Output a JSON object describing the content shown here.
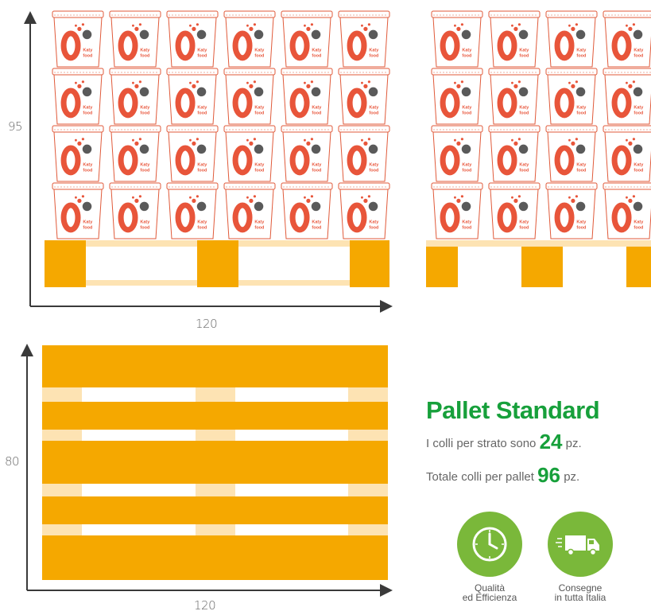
{
  "dimensions": {
    "front_height": "95",
    "front_width": "120",
    "top_depth": "80",
    "top_width": "120"
  },
  "product": {
    "brand_line1": "Katy",
    "brand_line2": "food",
    "rows": 4,
    "front_columns": 6
  },
  "info": {
    "title": "Pallet Standard",
    "per_layer_text": "I colli per strato sono",
    "per_layer_value": "24",
    "per_layer_unit": "pz.",
    "total_text": "Totale colli per pallet",
    "total_value": "96",
    "total_unit": "pz."
  },
  "badges": [
    {
      "icon": "clock-icon",
      "line1": "Qualità",
      "line2": "ed Efficienza"
    },
    {
      "icon": "truck-icon",
      "line1": "Consegne",
      "line2": "in tutta Italia"
    }
  ],
  "colors": {
    "pallet": "#f5a800",
    "pallet_light": "#fde3b3",
    "bucket_outline": "#e05a3a",
    "logo": "#e8553a",
    "accent_green": "#17a03b",
    "badge_green": "#7ab83a",
    "axis": "#3a3a3a"
  }
}
